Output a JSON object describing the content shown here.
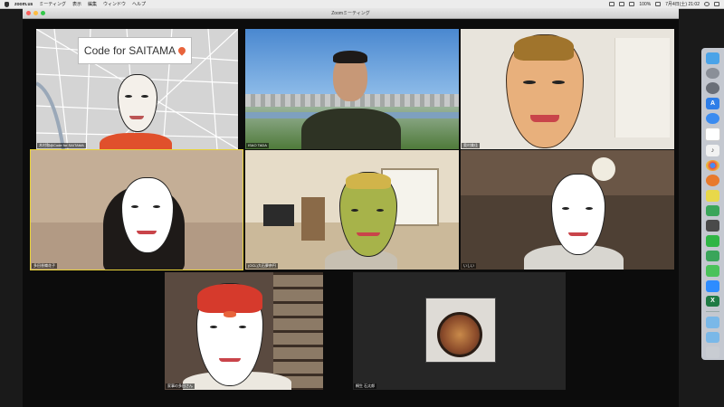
{
  "menubar": {
    "app_name": "zoom.us",
    "items": [
      "ミーティング",
      "表示",
      "編集",
      "ウィンドウ",
      "ヘルプ"
    ],
    "battery": "100%",
    "clock": "7月4日(土) 21:02"
  },
  "window": {
    "title": "Zoomミーティング"
  },
  "participants": [
    {
      "name": "木村和@Code for SAITAMA",
      "logo_text": "Code for SAITAMA"
    },
    {
      "name": "ISAO TADA"
    },
    {
      "name": "奥村美佳"
    },
    {
      "name": "多田香織花子"
    },
    {
      "name": "(OCL)大石夢奈円"
    },
    {
      "name": "いしい"
    },
    {
      "name": "家事の多田さん"
    },
    {
      "name": "桐生 石太郎"
    }
  ],
  "colors": {
    "active_speaker_border": "#e8d23a",
    "window_bg": "#0c0c0c"
  },
  "dock_icons": [
    "finder-icon",
    "launchpad-icon",
    "rocket-icon",
    "app-store-icon",
    "messenger-icon",
    "calendar-icon",
    "music-icon",
    "chrome-icon",
    "firefox-icon",
    "notes-icon",
    "evernote-icon",
    "calculator-icon",
    "line-icon",
    "spreadsheet-icon",
    "facetime-icon",
    "zoom-icon",
    "excel-icon",
    "folder-icon",
    "folder2-icon",
    "trash-icon"
  ]
}
